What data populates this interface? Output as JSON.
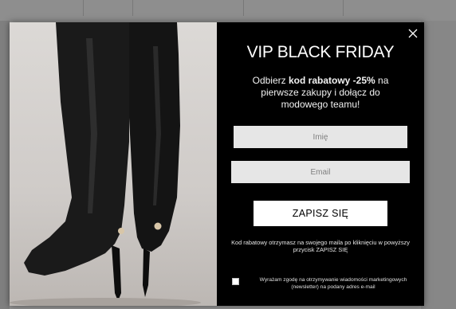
{
  "popup": {
    "title": "VIP BLACK FRIDAY",
    "subtitle_prefix": "Odbierz ",
    "subtitle_bold": "kod rabatowy -25%",
    "subtitle_suffix": " na pierwsze zakupy i dołącz do modowego teamu!",
    "name_placeholder": "Imię",
    "email_placeholder": "Email",
    "submit_label": "ZAPISZ SIĘ",
    "note": "Kod rabatowy otrzymasz na swojego maila po kliknięciu w powyższy przycisk ZAPISZ SIĘ",
    "consent_label": "Wyrażam zgodę na otrzymywanie wiadomości marketingowych (newsletter) na podany adres e-mail",
    "consent_checked": false
  },
  "icons": {
    "close": "close-icon"
  },
  "colors": {
    "form_background": "#000000",
    "button_background": "#ffffff",
    "input_background": "#e6e6e6"
  }
}
